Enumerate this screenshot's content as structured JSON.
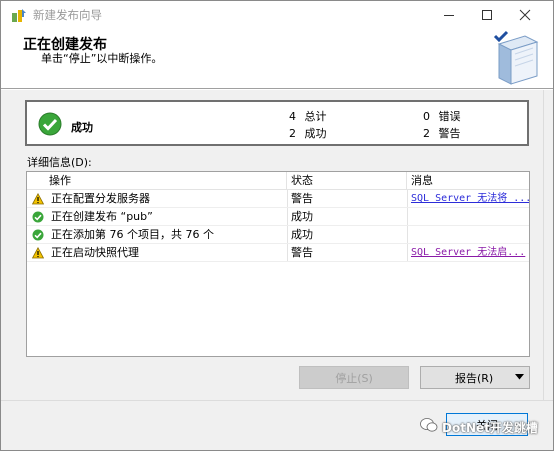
{
  "window": {
    "title": "新建发布向导",
    "app_icon": "wizard-icon",
    "controls": [
      "minimize-icon",
      "maximize-icon",
      "close-icon"
    ]
  },
  "header": {
    "title": "正在创建发布",
    "subtitle": "单击“停止”以中断操作。"
  },
  "summary": {
    "status": "成功",
    "total_count": "4",
    "total_label": "总计",
    "success_count": "2",
    "success_label": "成功",
    "error_count": "0",
    "error_label": "错误",
    "warning_count": "2",
    "warning_label": "警告"
  },
  "details": {
    "label": "详细信息(D):",
    "columns": [
      "操作",
      "状态",
      "消息"
    ],
    "rows": [
      {
        "icon": "warning-icon",
        "operation": "正在配置分发服务器",
        "status": "警告",
        "message": "SQL Server 无法将 ..."
      },
      {
        "icon": "success-icon",
        "operation": "正在创建发布 “pub”",
        "status": "成功",
        "message": ""
      },
      {
        "icon": "success-icon",
        "operation": "正在添加第 76 个项目，共 76 个",
        "status": "成功",
        "message": ""
      },
      {
        "icon": "warning-icon",
        "operation": "正在启动快照代理",
        "status": "警告",
        "message": "SQL Server 无法启..."
      }
    ]
  },
  "buttons": {
    "stop": "停止(S)",
    "report": "报告(R)",
    "close": "关闭"
  },
  "watermark": "DotNet开发跳槽",
  "colors": {
    "link": "#2c2cd9",
    "visited_link": "#8a1aa8",
    "success": "#3aa63a",
    "warning": "#f2c200"
  }
}
